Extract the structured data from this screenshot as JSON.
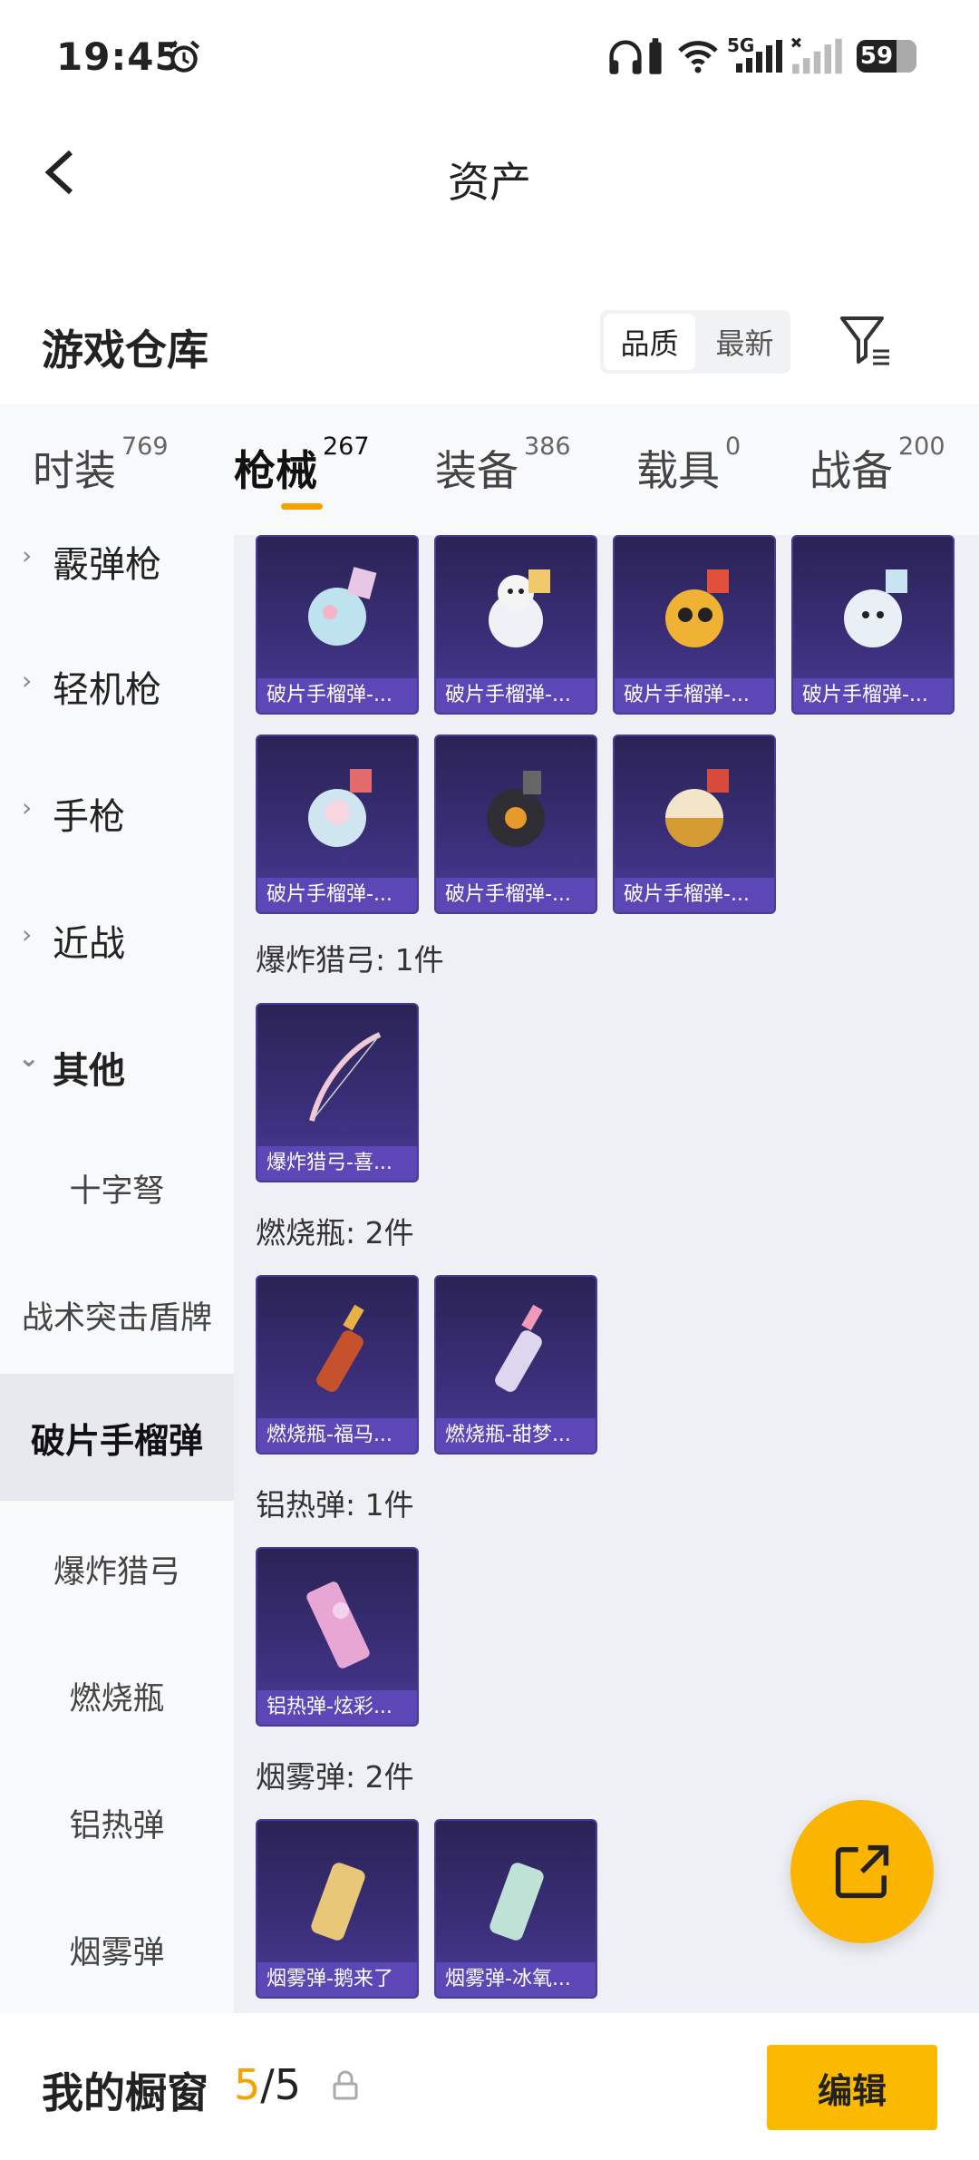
{
  "status": {
    "time": "19:45",
    "battery": "59",
    "network": "5G"
  },
  "nav": {
    "title": "资产"
  },
  "warehouse": {
    "title": "游戏仓库",
    "sort_quality": "品质",
    "sort_newest": "最新"
  },
  "tabs": [
    {
      "label": "时装",
      "count": "769"
    },
    {
      "label": "枪械",
      "count": "267"
    },
    {
      "label": "装备",
      "count": "386"
    },
    {
      "label": "载具",
      "count": "0"
    },
    {
      "label": "战备",
      "count": "200"
    }
  ],
  "sidebar": {
    "cats": [
      "霰弹枪",
      "轻机枪",
      "手枪",
      "近战",
      "其他"
    ],
    "subs": [
      "十字弩",
      "战术突击盾牌",
      "破片手榴弹",
      "爆炸猎弓",
      "燃烧瓶",
      "铝热弹",
      "烟雾弹"
    ]
  },
  "groups": {
    "bow": "爆炸猎弓: 1件",
    "molotov": "燃烧瓶: 2件",
    "thermite": "铝热弹: 1件",
    "smoke": "烟雾弹: 2件"
  },
  "cards": {
    "grenade": [
      "破片手榴弹-...",
      "破片手榴弹-...",
      "破片手榴弹-...",
      "破片手榴弹-...",
      "破片手榴弹-...",
      "破片手榴弹-...",
      "破片手榴弹-..."
    ],
    "bow": [
      "爆炸猎弓-喜..."
    ],
    "molotov": [
      "燃烧瓶-福马...",
      "燃烧瓶-甜梦..."
    ],
    "thermite": [
      "铝热弹-炫彩..."
    ],
    "smoke": [
      "烟雾弹-鹅来了",
      "烟雾弹-冰氧..."
    ]
  },
  "bottom": {
    "title": "我的橱窗",
    "current": "5",
    "total": "/5",
    "edit": "编辑"
  },
  "colors": {
    "accent": "#fbb900",
    "card": "#3b2f7a"
  }
}
